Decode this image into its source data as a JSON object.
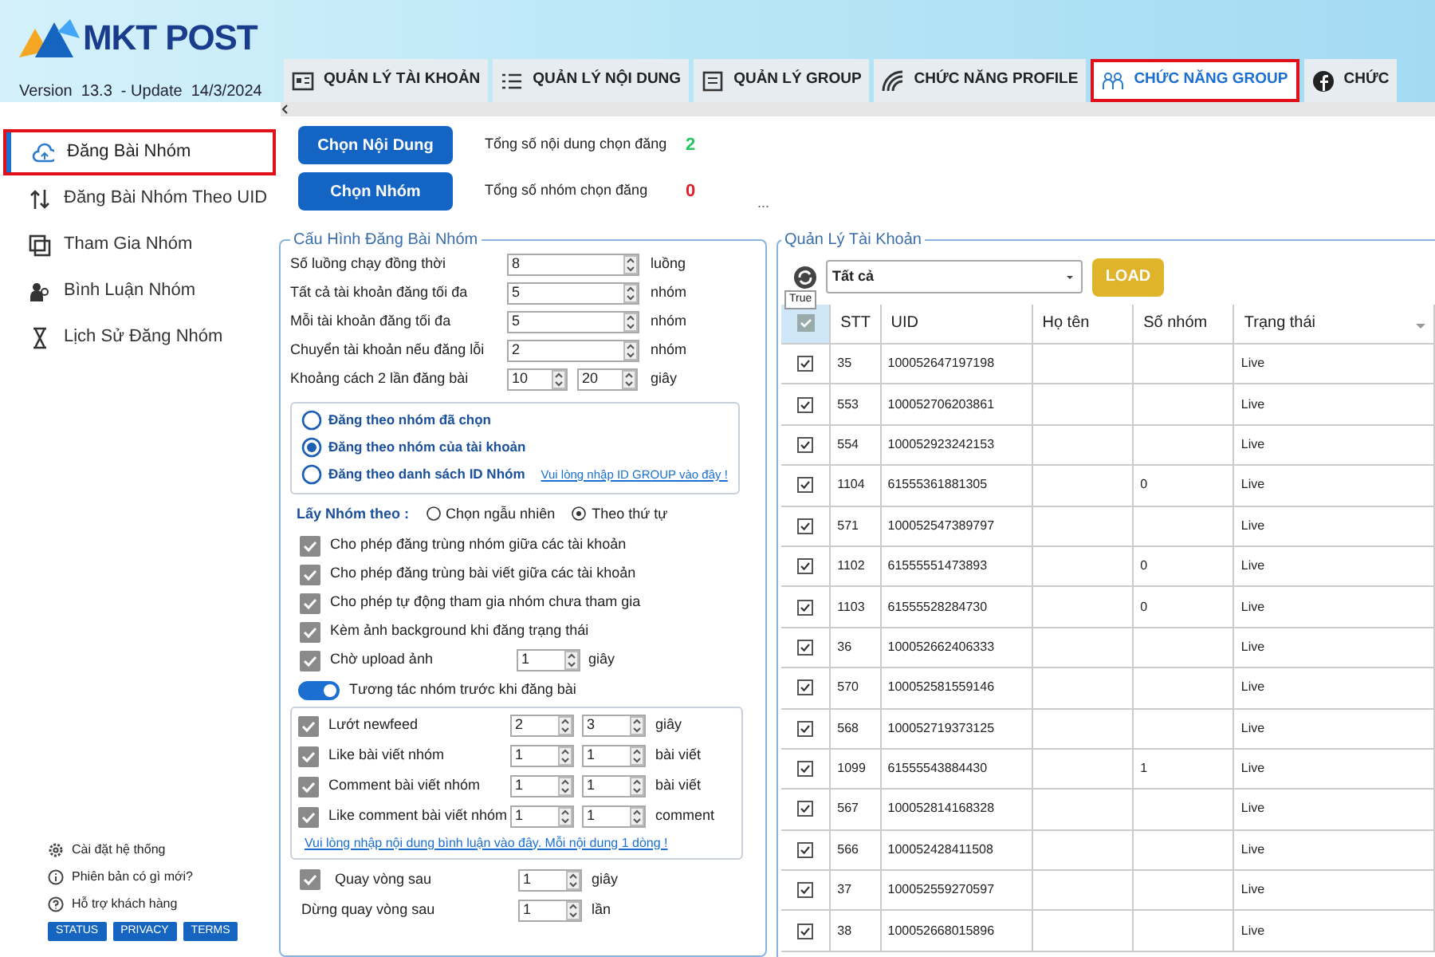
{
  "header": {
    "logo": "MKT POST",
    "version": "Version  13.3  - Update  14/3/2024"
  },
  "tabs": [
    {
      "label": "QUẢN LÝ TÀI KHOẢN",
      "selected": false
    },
    {
      "label": "QUẢN LÝ NỘI DUNG",
      "selected": false
    },
    {
      "label": "QUẢN LÝ GROUP",
      "selected": false
    },
    {
      "label": "CHỨC NĂNG PROFILE",
      "selected": false
    },
    {
      "label": "CHỨC NĂNG GROUP",
      "selected": true
    },
    {
      "label": "CHỨC",
      "selected": false
    }
  ],
  "sidebar": {
    "items": [
      {
        "label": "Đăng Bài Nhóm",
        "selected": true
      },
      {
        "label": "Đăng Bài Nhóm Theo UID",
        "selected": false
      },
      {
        "label": "Tham Gia Nhóm",
        "selected": false
      },
      {
        "label": "Bình Luận Nhóm",
        "selected": false
      },
      {
        "label": "Lịch Sử Đăng Nhóm",
        "selected": false
      }
    ],
    "links": [
      "Cài đặt hệ thống",
      "Phiên bản có gì mới?",
      "Hỗ trợ khách hàng"
    ],
    "badges": [
      "STATUS",
      "PRIVACY",
      "TERMS"
    ]
  },
  "pickers": [
    {
      "button": "Chọn Nội Dung",
      "summary": "Tổng số nội dung chọn đăng",
      "count": "2",
      "color": "#22c55e"
    },
    {
      "button": "Chọn Nhóm",
      "summary": "Tổng số nhóm chọn đăng",
      "count": "0",
      "color": "#e11d2a"
    }
  ],
  "ellipsis": "...",
  "config": {
    "title": "Cấu Hình Đăng Bài Nhóm",
    "fields": [
      {
        "label": "Số luồng chạy đồng thời",
        "values": [
          "8"
        ],
        "unit": "luồng"
      },
      {
        "label": "Tất cả tài khoản đăng tối đa",
        "values": [
          "5"
        ],
        "unit": "nhóm"
      },
      {
        "label": "Mỗi tài khoản đăng tối đa",
        "values": [
          "5"
        ],
        "unit": "nhóm"
      },
      {
        "label": "Chuyển tài khoản nếu đăng lỗi",
        "values": [
          "2"
        ],
        "unit": "nhóm"
      },
      {
        "label": "Khoảng cách 2 lần đăng bài",
        "values": [
          "10",
          "20"
        ],
        "unit": "giây"
      }
    ],
    "post_modes": [
      {
        "label": "Đăng theo nhóm đã chọn",
        "selected": false
      },
      {
        "label": "Đăng theo nhóm của tài khoản",
        "selected": true
      },
      {
        "label": "Đăng theo danh sách ID Nhóm",
        "selected": false,
        "link": "Vui lòng nhập ID GROUP vào đây !"
      }
    ],
    "pick_by": {
      "label": "Lấy Nhóm theo :",
      "options": [
        {
          "label": "Chọn ngẫu nhiên",
          "selected": false
        },
        {
          "label": "Theo thứ tự",
          "selected": true
        }
      ]
    },
    "options": [
      {
        "label": "Cho phép đăng trùng nhóm giữa các tài khoản",
        "checked": true
      },
      {
        "label": "Cho phép đăng trùng bài viết giữa các tài khoản",
        "checked": true
      },
      {
        "label": "Cho phép tự động tham gia nhóm chưa tham gia",
        "checked": true
      },
      {
        "label": "Kèm ảnh background khi đăng trạng thái",
        "checked": true
      },
      {
        "label": "Chờ upload ảnh",
        "checked": true,
        "value": "1",
        "unit": "giây"
      }
    ],
    "interact": {
      "label": "Tương tác nhóm trước khi đăng bài",
      "on": true,
      "rows": [
        {
          "label": "Lướt newfeed",
          "checked": true,
          "values": [
            "2",
            "3"
          ],
          "unit": "giây"
        },
        {
          "label": "Like bài viết nhóm",
          "checked": true,
          "values": [
            "1",
            "1"
          ],
          "unit": "bài viết"
        },
        {
          "label": "Comment bài viết nhóm",
          "checked": true,
          "values": [
            "1",
            "1"
          ],
          "unit": "bài viết"
        },
        {
          "label": "Like comment bài viết nhóm",
          "checked": true,
          "values": [
            "1",
            "1"
          ],
          "unit": "comment"
        }
      ],
      "link": "Vui lòng nhập nội dung bình luận vào đây. Mỗi nội dung 1 dòng !"
    },
    "loop": [
      {
        "kind": "check",
        "label": "Quay vòng sau",
        "checked": true,
        "value": "1",
        "unit": "giây"
      },
      {
        "kind": "plain",
        "label": "Dừng quay vòng sau",
        "value": "1",
        "unit": "lần"
      }
    ]
  },
  "accounts": {
    "title": "Quản Lý Tài Khoản",
    "filter": "Tất cả",
    "load": "LOAD",
    "tooltip": "True",
    "all_checked": true,
    "columns": [
      "STT",
      "UID",
      "Họ tên",
      "Số nhóm",
      "Trạng thái"
    ],
    "rows": [
      {
        "checked": true,
        "stt": "35",
        "uid": "100052647197198",
        "status": "Live"
      },
      {
        "checked": true,
        "stt": "553",
        "uid": "100052706203861",
        "status": "Live"
      },
      {
        "checked": true,
        "stt": "554",
        "uid": "100052923242153",
        "status": "Live"
      },
      {
        "checked": true,
        "stt": "1104",
        "uid": "61555361881305",
        "groups": "0",
        "status": "Live"
      },
      {
        "checked": true,
        "stt": "571",
        "uid": "100052547389797",
        "status": "Live"
      },
      {
        "checked": true,
        "stt": "1102",
        "uid": "61555551473893",
        "groups": "0",
        "status": "Live"
      },
      {
        "checked": true,
        "stt": "1103",
        "uid": "61555528284730",
        "groups": "0",
        "status": "Live"
      },
      {
        "checked": true,
        "stt": "36",
        "uid": "100052662406333",
        "status": "Live"
      },
      {
        "checked": true,
        "stt": "570",
        "uid": "100052581559146",
        "status": "Live"
      },
      {
        "checked": true,
        "stt": "568",
        "uid": "100052719373125",
        "status": "Live"
      },
      {
        "checked": true,
        "stt": "1099",
        "uid": "61555543884430",
        "groups": "1",
        "status": "Live"
      },
      {
        "checked": true,
        "stt": "567",
        "uid": "100052814168328",
        "status": "Live"
      },
      {
        "checked": true,
        "stt": "566",
        "uid": "100052428411508",
        "status": "Live"
      },
      {
        "checked": true,
        "stt": "37",
        "uid": "100052559270597",
        "status": "Live"
      },
      {
        "checked": true,
        "stt": "38",
        "uid": "100052668015896",
        "status": "Live"
      }
    ]
  }
}
